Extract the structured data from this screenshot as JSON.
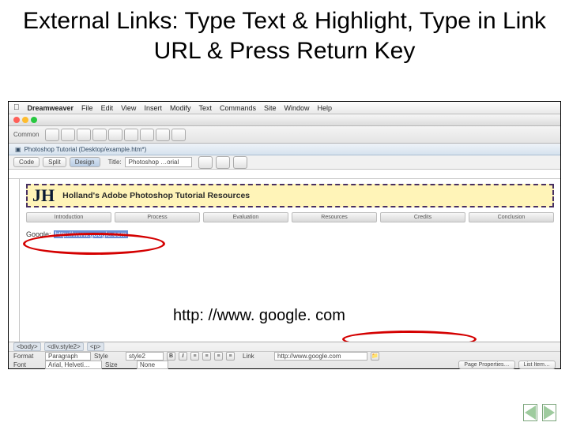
{
  "slide": {
    "title": "External Links: Type Text & Highlight, Type in Link URL & Press Return Key",
    "annotation_url": "http: //www. google. com"
  },
  "mac_menu": {
    "app": "Dreamweaver",
    "items": [
      "File",
      "Edit",
      "View",
      "Insert",
      "Modify",
      "Text",
      "Commands",
      "Site",
      "Window",
      "Help"
    ]
  },
  "window": {
    "title": "Photoshop Tutorial (Desktop/example.htm*)"
  },
  "toolbar": {
    "tab_label": "Common"
  },
  "viewstrip": {
    "code": "Code",
    "split": "Split",
    "design": "Design",
    "title_label": "Title:",
    "title_value": "Photoshop …orial"
  },
  "banner": {
    "logo": "JH",
    "title": "Holland's Adobe Photoshop Tutorial Resources"
  },
  "nav_tabs": [
    "Introduction",
    "Process",
    "Evaluation",
    "Resources",
    "Credits",
    "Conclusion"
  ],
  "linkline": {
    "label": "Google:",
    "highlighted": "http://www.google.com"
  },
  "tagpath": [
    "<body>",
    "<div.style2>",
    "<p>"
  ],
  "props": {
    "format_label": "Format",
    "format_value": "Paragraph",
    "style_label": "Style",
    "style_value": "style2",
    "link_label": "Link",
    "link_value": "http://www.google.com",
    "font_label": "Font",
    "font_value": "Arial, Helveti…",
    "size_label": "Size",
    "size_value": "None",
    "page_props": "Page Properties…",
    "list_item": "List Item…",
    "b": "B",
    "i": "I"
  }
}
